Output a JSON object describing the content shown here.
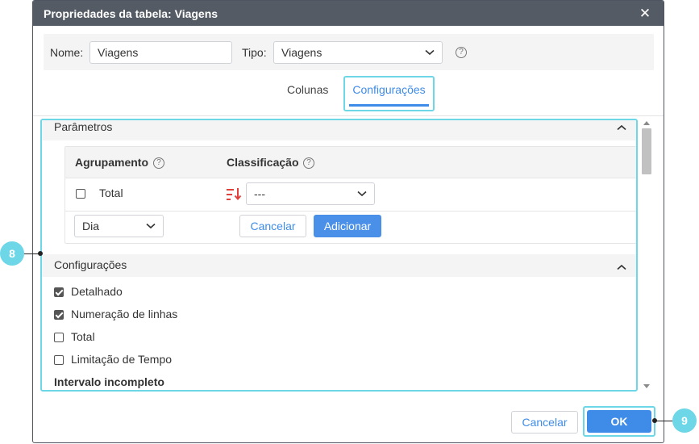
{
  "dialog": {
    "title": "Propriedades da tabela: Viagens",
    "close_glyph": "✕"
  },
  "header": {
    "nome_label": "Nome:",
    "nome_value": "Viagens",
    "tipo_label": "Tipo:",
    "tipo_value": "Viagens",
    "help_glyph": "?"
  },
  "tabs": [
    {
      "label": "Colunas",
      "active": false
    },
    {
      "label": "Configurações",
      "active": true
    }
  ],
  "parametros": {
    "title": "Parâmetros",
    "agrupamento_header": "Agrupamento",
    "classificacao_header": "Classificação",
    "row": {
      "checkbox_label": "Total",
      "checked": false,
      "sort_value": "---"
    },
    "grouping_select_value": "Dia",
    "cancel_label": "Cancelar",
    "add_label": "Adicionar"
  },
  "configuracoes": {
    "title": "Configurações",
    "options": [
      {
        "label": "Detalhado",
        "checked": true
      },
      {
        "label": "Numeração de linhas",
        "checked": true
      },
      {
        "label": "Total",
        "checked": false
      },
      {
        "label": "Limitação de Tempo",
        "checked": false
      }
    ],
    "next_heading": "Intervalo incompleto"
  },
  "footer": {
    "cancel_label": "Cancelar",
    "ok_label": "OK"
  },
  "callouts": {
    "left": "8",
    "right": "9"
  },
  "colors": {
    "titlebar": "#555b65",
    "accent": "#3f8ce8",
    "highlight": "#6dd6e7",
    "sort_icon": "#e2403a"
  }
}
